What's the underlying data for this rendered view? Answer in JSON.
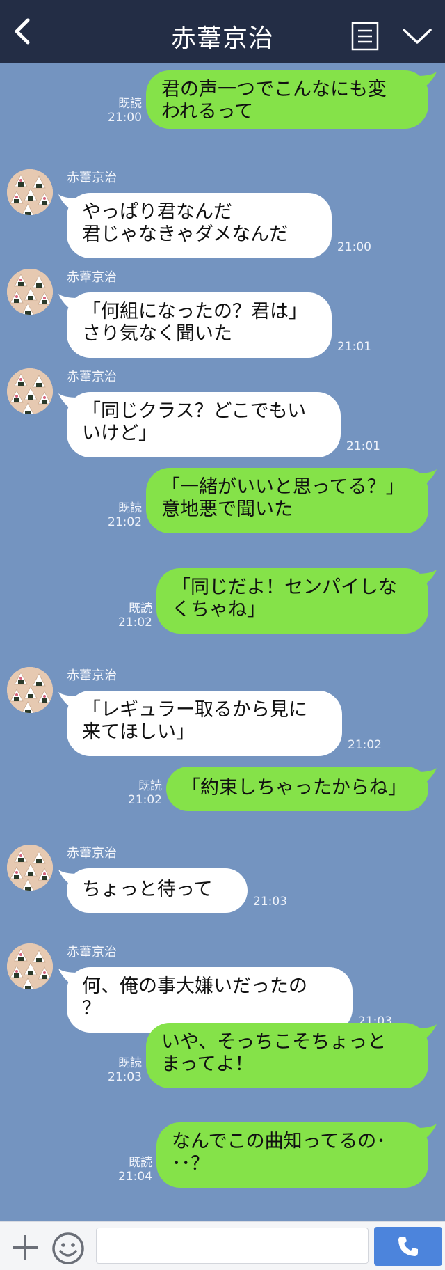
{
  "header": {
    "title": "赤葦京治",
    "back_icon": "chevron-left-icon",
    "menu_icon": "note-menu-icon",
    "collapse_icon": "chevron-down-icon"
  },
  "colors": {
    "header_bg": "#232d45",
    "chat_bg": "#7494c0",
    "outgoing_bubble": "#85e249",
    "incoming_bubble": "#ffffff",
    "call_button": "#4c84dc"
  },
  "messages": [
    {
      "dir": "out",
      "text": "君の声一つでこんなにも変\nわれるって",
      "read": "既読",
      "time": "21:00"
    },
    {
      "dir": "in",
      "sender": "赤葦京治",
      "text": "やっぱり君なんだ\n君じゃなきゃダメなんだ",
      "time": "21:00"
    },
    {
      "dir": "in",
      "sender": "赤葦京治",
      "text": "「何組になったの？君は」\nさり気なく聞いた",
      "time": "21:01"
    },
    {
      "dir": "in",
      "sender": "赤葦京治",
      "text": "「同じクラス？どこでもい\nいけど」",
      "time": "21:01"
    },
    {
      "dir": "out",
      "text": "「一緒がいいと思ってる？」\n意地悪で聞いた",
      "read": "既読",
      "time": "21:02"
    },
    {
      "dir": "out",
      "text": "「同じだよ！センパイしな\nくちゃね」",
      "read": "既読",
      "time": "21:02"
    },
    {
      "dir": "in",
      "sender": "赤葦京治",
      "text": "「レギュラー取るから見に\n来てほしい」",
      "time": "21:02"
    },
    {
      "dir": "out",
      "text": "「約束しちゃったからね」",
      "read": "既読",
      "time": "21:02"
    },
    {
      "dir": "in",
      "sender": "赤葦京治",
      "text": "ちょっと待って",
      "time": "21:03"
    },
    {
      "dir": "in",
      "sender": "赤葦京治",
      "text": "何、俺の事大嫌いだったの\n？",
      "time": "21:03"
    },
    {
      "dir": "out",
      "text": "いや、そっちこそちょっと\nまってよ！",
      "read": "既読",
      "time": "21:03"
    },
    {
      "dir": "out",
      "text": "なんでこの曲知ってるの･\n･･？",
      "read": "既読",
      "time": "21:04"
    }
  ],
  "input_bar": {
    "plus_icon": "plus-icon",
    "emoji_icon": "smiley-icon",
    "message_value": "",
    "call_icon": "phone-icon"
  }
}
